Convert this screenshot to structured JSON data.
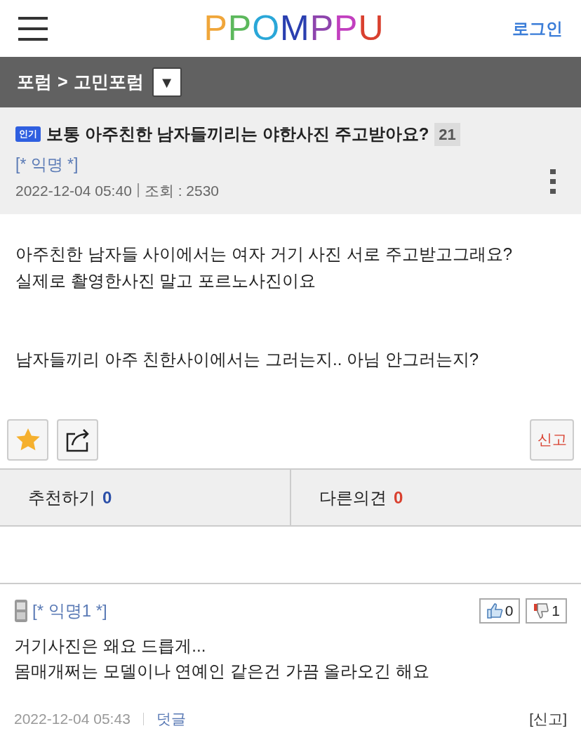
{
  "header": {
    "logo": "PPOMPPU",
    "login": "로그인"
  },
  "breadcrumb": {
    "forum": "포럼",
    "separator": ">",
    "board": "고민포럼",
    "dropdown": "▼"
  },
  "post": {
    "badge": "인기",
    "title": "보통 아주친한 남자들끼리는 야한사진 주고받아요?",
    "comment_count": "21",
    "author": "[* 익명 *]",
    "date": "2022-12-04 05:40",
    "views_label": "조회 : 2530"
  },
  "body": {
    "paragraphs": [
      [
        "아주친한 남자들 사이에서는 여자 거기 사진 서로 주고받고그래요?",
        "실제로 촬영한사진 말고 포르노사진이요"
      ],
      [
        "남자들끼리 아주 친한사이에서는 그러는지.. 아님 안그러는지?"
      ]
    ]
  },
  "actions": {
    "report": "신고"
  },
  "votes": [
    {
      "label": "추천하기",
      "count": "0",
      "color": "#2b4fa8"
    },
    {
      "label": "다른의견",
      "count": "0",
      "color": "#d9402f"
    }
  ],
  "comments": [
    {
      "author": "[* 익명1 *]",
      "likes": "0",
      "dislikes": "1",
      "lines": [
        "거기사진은 왜요 드릅게...",
        "몸매개쩌는 모델이나 연예인 같은건 가끔 올라오긴 해요"
      ],
      "date": "2022-12-04 05:43",
      "reply": "덧글",
      "report": "[신고]"
    }
  ]
}
